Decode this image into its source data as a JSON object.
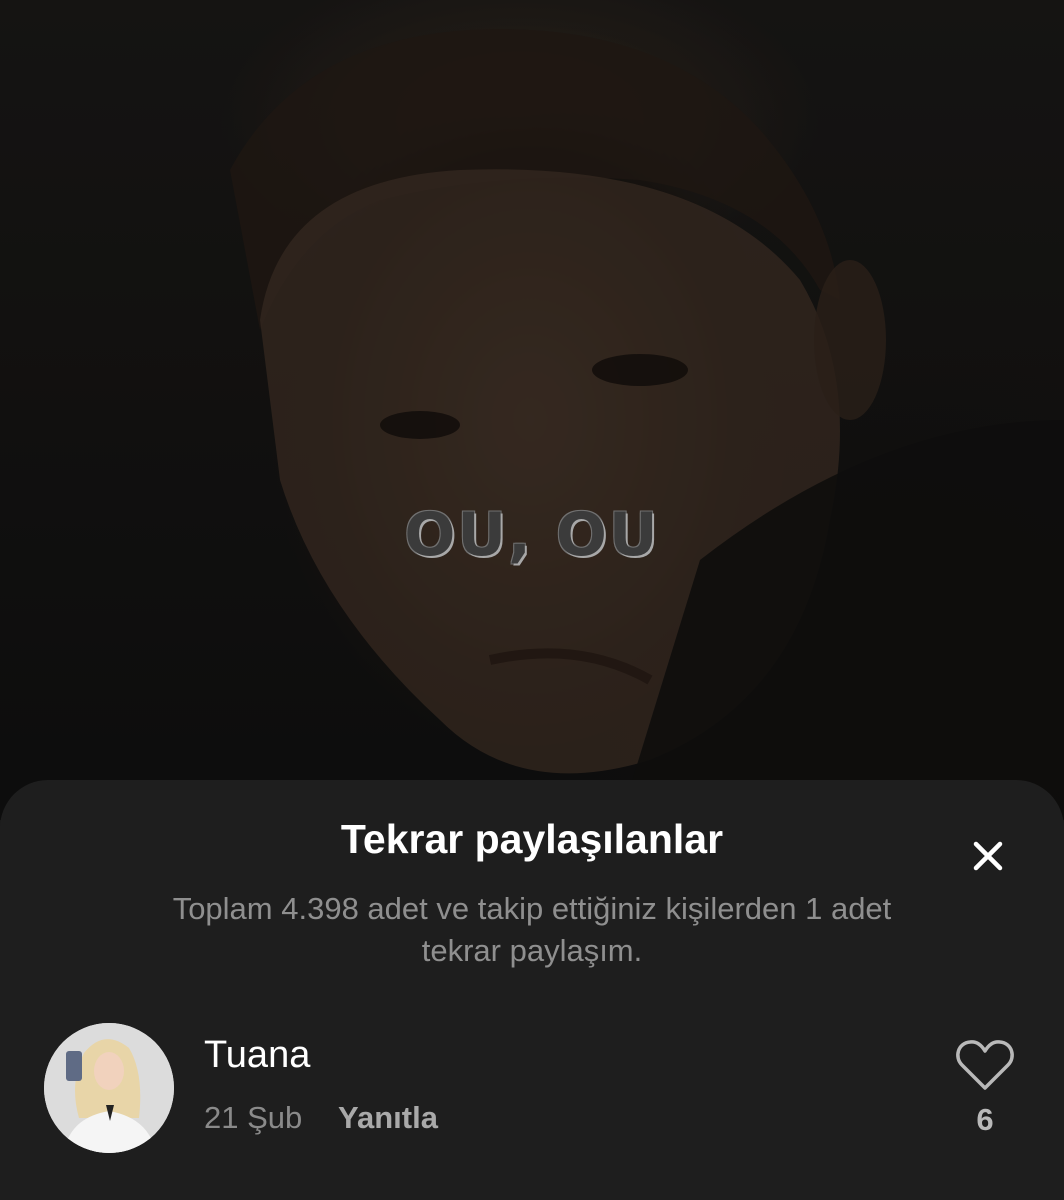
{
  "video": {
    "caption": "OU, OU"
  },
  "sheet": {
    "title": "Tekrar paylaşılanlar",
    "subtitle": "Toplam 4.398 adet ve takip ettiğiniz kişilerden 1 adet tekrar paylaşım.",
    "close_icon": "close-icon"
  },
  "reposts": [
    {
      "username": "Tuana",
      "date": "21 Şub",
      "reply_label": "Yanıtla",
      "like_count": "6",
      "like_icon": "heart-outline-icon"
    }
  ],
  "colors": {
    "sheet_background": "#1e1e1e",
    "title": "#ffffff",
    "subtitle": "#8f8f8f",
    "secondary_text": "#8a8a8a"
  }
}
